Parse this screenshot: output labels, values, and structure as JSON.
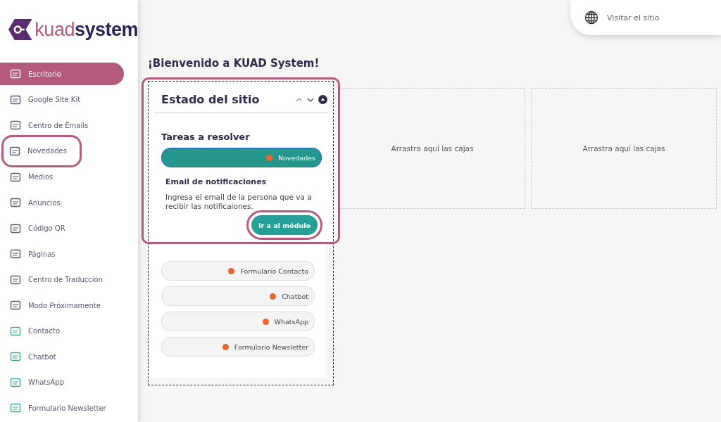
{
  "logo": {
    "part_1": "kuad",
    "part_2": "system"
  },
  "sidebar": {
    "items": [
      {
        "label": "Escritorio",
        "selected": true,
        "highlighted": false
      },
      {
        "label": "Google Site Kit",
        "selected": false,
        "highlighted": false
      },
      {
        "label": "Centro de Emails",
        "selected": false,
        "highlighted": false
      },
      {
        "label": "Novedades",
        "selected": false,
        "highlighted": true
      },
      {
        "label": "Medios",
        "selected": false,
        "highlighted": false
      },
      {
        "label": "Anuncios",
        "selected": false,
        "highlighted": false
      },
      {
        "label": "Código QR",
        "selected": false,
        "highlighted": false
      },
      {
        "label": "Páginas",
        "selected": false,
        "highlighted": false
      },
      {
        "label": "Centro de Traducción",
        "selected": false,
        "highlighted": false
      },
      {
        "label": "Modo Próximamente",
        "selected": false,
        "highlighted": false
      },
      {
        "label": "Contacto",
        "selected": false,
        "highlighted": false
      },
      {
        "label": "Chatbot",
        "selected": false,
        "highlighted": false
      },
      {
        "label": "WhatsApp",
        "selected": false,
        "highlighted": false
      },
      {
        "label": "Formulario Newsletter",
        "selected": false,
        "highlighted": false
      }
    ]
  },
  "top_bar": {
    "visit_link": "Visitar el sitio"
  },
  "heading": "¡Bienvenido a KUAD System!",
  "widget": {
    "title": "Estado del sitio",
    "highlighted": true,
    "section_title": "Tareas a resolver",
    "tasks": [
      {
        "label": "Novedades",
        "expanded": true,
        "color": "#e8662d",
        "detail_title": "Email de notificaciones",
        "detail_text": "Ingresa el email de la persona que va a recibir las notificaiones.",
        "button": "Ir a al módulo",
        "button_highlighted": true
      },
      {
        "label": "Formulario Contacto",
        "expanded": false,
        "color": "#e8662d"
      },
      {
        "label": "Chatbot",
        "expanded": false,
        "color": "#e8662d"
      },
      {
        "label": "WhatsApp",
        "expanded": false,
        "color": "#e8662d"
      },
      {
        "label": "Formulario Newsletter",
        "expanded": false,
        "color": "#e8662d"
      }
    ]
  },
  "drop_zones": [
    "Arrastra aquí las cajas",
    "Arrastra aquí las cajas"
  ]
}
